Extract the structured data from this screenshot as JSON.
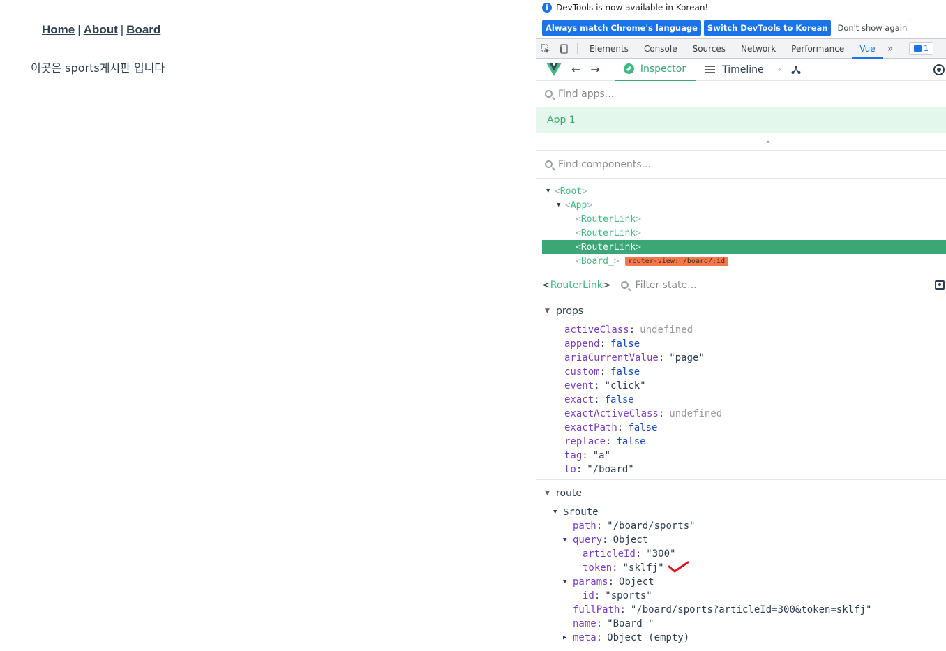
{
  "page": {
    "nav": {
      "home": "Home",
      "about": "About",
      "board": "Board",
      "separator": "|"
    },
    "body_text": "이곳은 sports게시판 입니다"
  },
  "devtools": {
    "infobar": {
      "message": "DevTools is now available in Korean!",
      "btn_match": "Always match Chrome's language",
      "btn_switch": "Switch DevTools to Korean",
      "btn_dismiss": "Don't show again"
    },
    "tabs": [
      "Elements",
      "Console",
      "Sources",
      "Network",
      "Performance",
      "Vue"
    ],
    "active_tab": "Vue",
    "more_tabs": "»",
    "issues_count": "1",
    "vue": {
      "inspector_label": "Inspector",
      "timeline_label": "Timeline",
      "find_apps_placeholder": "Find apps...",
      "app_label": "App 1",
      "find_components_placeholder": "Find components...",
      "tree": [
        {
          "name": "Root",
          "indent": 0,
          "expanded": true
        },
        {
          "name": "App",
          "indent": 1,
          "expanded": true
        },
        {
          "name": "RouterLink",
          "indent": 2
        },
        {
          "name": "RouterLink",
          "indent": 2
        },
        {
          "name": "RouterLink",
          "indent": 2,
          "selected": true
        },
        {
          "name": "Board_",
          "indent": 2,
          "badge": "router-view: /board/:id"
        }
      ],
      "selected_component": "RouterLink",
      "filter_state_placeholder": "Filter state...",
      "sections": {
        "props_title": "props",
        "route_title": "route"
      },
      "props": [
        {
          "key": "activeClass",
          "value": "undefined",
          "kind": "undef"
        },
        {
          "key": "append",
          "value": "false",
          "kind": "bool"
        },
        {
          "key": "ariaCurrentValue",
          "value": "\"page\"",
          "kind": "str"
        },
        {
          "key": "custom",
          "value": "false",
          "kind": "bool"
        },
        {
          "key": "event",
          "value": "\"click\"",
          "kind": "str"
        },
        {
          "key": "exact",
          "value": "false",
          "kind": "bool"
        },
        {
          "key": "exactActiveClass",
          "value": "undefined",
          "kind": "undef"
        },
        {
          "key": "exactPath",
          "value": "false",
          "kind": "bool"
        },
        {
          "key": "replace",
          "value": "false",
          "kind": "bool"
        },
        {
          "key": "tag",
          "value": "\"a\"",
          "kind": "str"
        },
        {
          "key": "to",
          "value": "\"/board\"",
          "kind": "str"
        }
      ],
      "route": [
        {
          "key": "$route",
          "value": "",
          "level": 0,
          "toggle": "open"
        },
        {
          "key": "path",
          "value": "\"/board/sports\"",
          "level": 1,
          "kind": "str"
        },
        {
          "key": "query",
          "value": "Object",
          "level": 1,
          "kind": "obj",
          "toggle": "open"
        },
        {
          "key": "articleId",
          "value": "\"300\"",
          "level": 2,
          "kind": "str"
        },
        {
          "key": "token",
          "value": "\"sklfj\"",
          "level": 2,
          "kind": "str"
        },
        {
          "key": "params",
          "value": "Object",
          "level": 1,
          "kind": "obj",
          "toggle": "open"
        },
        {
          "key": "id",
          "value": "\"sports\"",
          "level": 2,
          "kind": "str"
        },
        {
          "key": "fullPath",
          "value": "\"/board/sports?articleId=300&token=sklfj\"",
          "level": 1,
          "kind": "str"
        },
        {
          "key": "name",
          "value": "\"Board_\"",
          "level": 1,
          "kind": "str"
        },
        {
          "key": "meta",
          "value": "Object (empty)",
          "level": 1,
          "kind": "obj",
          "toggle": "closed"
        }
      ]
    }
  },
  "colors": {
    "vue_green": "#42b883",
    "selection_green": "#3ba776",
    "chrome_blue": "#1a73e8",
    "badge_orange": "#f4784c",
    "annotation_red": "#e0141e"
  }
}
